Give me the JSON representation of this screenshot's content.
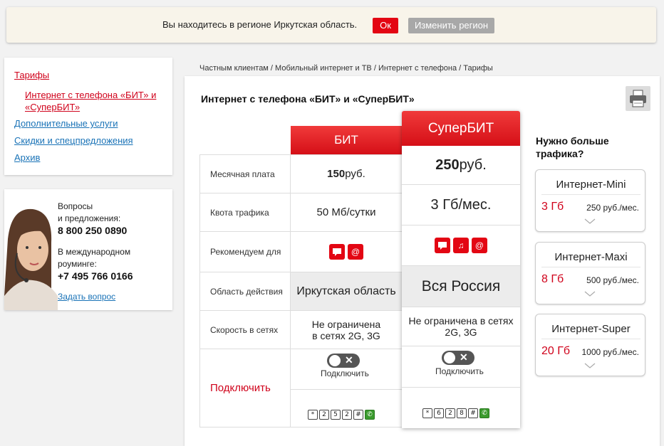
{
  "region_bar": {
    "text": "Вы находитесь в регионе Иркутская область.",
    "ok_label": "Ок",
    "change_label": "Изменить регион"
  },
  "sidebar": {
    "items": [
      {
        "label": "Тарифы"
      },
      {
        "label_line1": "Интернет с телефона «БИТ» и",
        "label_line2": "«СуперБИТ»"
      },
      {
        "label": "Дополнительные услуги"
      },
      {
        "label": "Скидки и спецпредложения"
      },
      {
        "label": "Архив"
      }
    ]
  },
  "contact": {
    "q_line1": "Вопросы",
    "q_line2": "и предложения:",
    "phone1": "8 800 250 0890",
    "roam_line1": "В международном",
    "roam_line2": "роуминге:",
    "phone2": "+7 495 766 0166",
    "ask_link": "Задать вопрос"
  },
  "breadcrumb": "Частным клиентам / Мобильный интернет и ТВ / Интернет с телефона / Тарифы",
  "page_title": "Интернет с телефона «БИТ» и «СуперБИТ»",
  "table": {
    "row_labels": [
      "Месячная плата",
      "Квота трафика",
      "Рекомендуем для",
      "Область действия",
      "Скорость в сетях",
      "Подключить"
    ],
    "bit": {
      "name": "БИТ",
      "price_num": "150",
      "price_unit": " руб.",
      "quota": "50 Мб/сутки",
      "area": "Иркутская область",
      "speed_line1": "Не ограничена",
      "speed_line2": "в сетях 2G, 3G",
      "connect_label": "Подключить",
      "ussd": [
        "*",
        "2",
        "5",
        "2",
        "#"
      ]
    },
    "superbit": {
      "name": "СуперБИТ",
      "price_num": "250",
      "price_unit": " руб.",
      "quota": "3 Гб/мес.",
      "area": "Вся Россия",
      "speed_line1": "Не ограничена в сетях",
      "speed_line2": "2G, 3G",
      "connect_label": "Подключить",
      "ussd": [
        "*",
        "6",
        "2",
        "8",
        "#"
      ]
    }
  },
  "more_traffic": {
    "title_line1": "Нужно больше",
    "title_line2": "трафика?",
    "packages": [
      {
        "name": "Интернет-Mini",
        "gb": "3 Гб",
        "price": "250 руб./мес."
      },
      {
        "name": "Интернет-Maxi",
        "gb": "8 Гб",
        "price": "500 руб./мес."
      },
      {
        "name": "Интернет-Super",
        "gb": "20 Гб",
        "price": "1000 руб./мес."
      }
    ]
  },
  "icons": {
    "sms": "sms-icon",
    "email": "at-icon",
    "music": "music-icon",
    "print": "printer-icon",
    "call": "call-icon",
    "chevron": "chevron-down-icon",
    "toggle_off": "toggle-off-icon"
  },
  "colors": {
    "accent": "#e30613",
    "link": "#1a73b7"
  }
}
